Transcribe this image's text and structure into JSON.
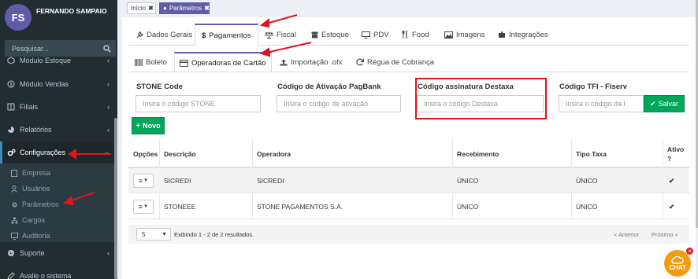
{
  "user": {
    "initials": "FS",
    "name": "FERNANDO SAMPAIO"
  },
  "search": {
    "placeholder": "Pesquisar..."
  },
  "sidebar": {
    "items": [
      {
        "label": "Módulo Estoque",
        "icon": "cube-icon"
      },
      {
        "label": "Módulo Vendas",
        "icon": "dollar-circle-icon"
      },
      {
        "label": "Filiais",
        "icon": "columns-icon"
      },
      {
        "label": "Relatórios",
        "icon": "pie-chart-icon"
      },
      {
        "label": "Configurações",
        "icon": "cogs-icon"
      },
      {
        "label": "Suporte",
        "icon": "globe-icon"
      },
      {
        "label": "Avalie o sistema",
        "icon": "pencil-icon"
      }
    ],
    "submenu": [
      {
        "label": "Empresa",
        "icon": "building-icon"
      },
      {
        "label": "Usuários",
        "icon": "user-icon"
      },
      {
        "label": "Parâmetros",
        "icon": "gear-icon"
      },
      {
        "label": "Cargos",
        "icon": "sitemap-icon"
      },
      {
        "label": "Auditoria",
        "icon": "monitor-icon"
      }
    ]
  },
  "breadcrumbs": [
    {
      "label": "Início"
    },
    {
      "label": "Parâmetros"
    }
  ],
  "tabs": [
    {
      "label": "Dados Gerais",
      "icon": "wrench-icon"
    },
    {
      "label": "Pagamentos",
      "icon": "dollar-icon"
    },
    {
      "label": "Fiscal",
      "icon": "balance-icon"
    },
    {
      "label": "Estoque",
      "icon": "box-icon"
    },
    {
      "label": "PDV",
      "icon": "monitor-icon"
    },
    {
      "label": "Food",
      "icon": "cutlery-icon"
    },
    {
      "label": "Imagens",
      "icon": "image-icon"
    },
    {
      "label": "Integrações",
      "icon": "puzzle-icon"
    }
  ],
  "subtabs": [
    {
      "label": "Boleto",
      "icon": "barcode-icon"
    },
    {
      "label": "Operadoras de Cartão",
      "icon": "credit-card-icon"
    },
    {
      "label": "Importação .ofx",
      "icon": "upload-icon"
    },
    {
      "label": "Régua de Cobrança",
      "icon": "refresh-icon"
    }
  ],
  "fields": {
    "stone": {
      "label": "STONE Code",
      "placeholder": "Insira o código STONE"
    },
    "pagbank": {
      "label": "Código de Ativação PagBank",
      "placeholder": "Insira o código de ativação"
    },
    "destaxa": {
      "label": "Código assinatura Destaxa",
      "placeholder": "Insira o código Destaxa"
    },
    "fiserv": {
      "label": "Código TFI - Fiserv",
      "placeholder": "Insira o código da l"
    }
  },
  "buttons": {
    "save": "Salvar",
    "new": "Novo"
  },
  "table": {
    "headers": {
      "options": "Opções",
      "description": "Descrição",
      "operator": "Operadora",
      "receipt": "Recebimento",
      "fee_type": "Tipo Taxa",
      "active_1": "Ativo",
      "active_2": "?"
    },
    "rows": [
      {
        "description": "SICREDI",
        "operator": "SICREDI",
        "receipt": "ÚNICO",
        "fee_type": "ÚNICO",
        "active": true
      },
      {
        "description": "STONEEE",
        "operator": "STONE PAGAMENTOS S.A.",
        "receipt": "ÚNICO",
        "fee_type": "ÚNICO",
        "active": true
      }
    ],
    "footer": {
      "per_page": "5",
      "results": "Exibindo 1 - 2 de 2 resultados.",
      "prev": "« Anterior",
      "next": "Próximo »"
    }
  },
  "chat": {
    "label": "CHAT"
  },
  "colors": {
    "sidebar": "#222d32",
    "accent": "#605ca8",
    "success": "#00a65a",
    "highlight": "#e0141e",
    "chat": "#f39c12"
  }
}
